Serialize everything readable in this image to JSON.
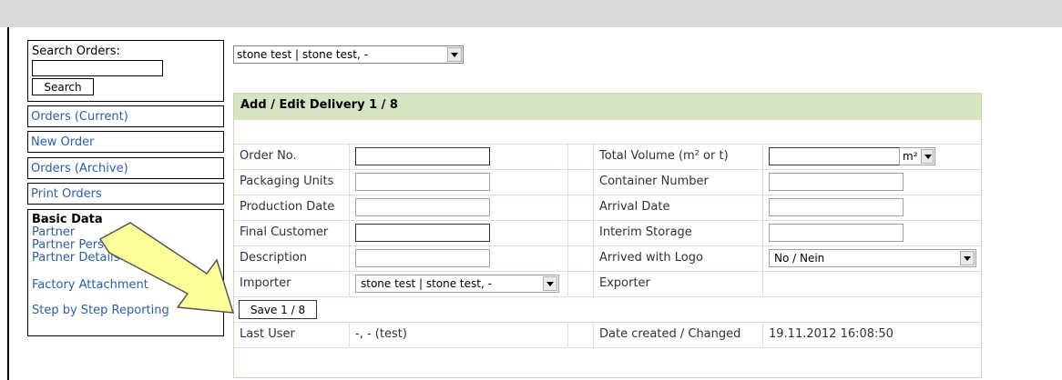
{
  "sidebar": {
    "search_label": "Search Orders:",
    "search_value": "",
    "search_button": "Search",
    "nav": [
      "Orders (Current)",
      "New Order",
      "Orders (Archive)",
      "Print Orders"
    ],
    "basic_data": {
      "title": "Basic Data",
      "links": [
        "Partner",
        "Partner Persons",
        "Partner Details",
        "Factory Attachment",
        "Step by Step Reporting"
      ]
    }
  },
  "top_select": {
    "value": "stone test | stone test, -"
  },
  "form": {
    "title": "Add / Edit Delivery 1 / 8",
    "left_labels": [
      "Order No.",
      "Packaging Units",
      "Production Date",
      "Final Customer",
      "Description",
      "Importer"
    ],
    "right_labels": [
      "Total Volume (m² or t)",
      "Container Number",
      "Arrival Date",
      "Interim Storage",
      "Arrived with Logo",
      "Exporter"
    ],
    "importer_value": "stone test | stone test, -",
    "unit_value": "m²",
    "logo_value": "No / Nein",
    "save_button": "Save 1 / 8",
    "last_user_label": "Last User",
    "last_user_value": "-, - (test)",
    "date_label": "Date created / Changed",
    "date_value": "19.11.2012 16:08:50"
  },
  "colors": {
    "link": "#2c5ea8",
    "header_bg": "#d6e4c4",
    "arrow_fill": "#ffff99"
  }
}
